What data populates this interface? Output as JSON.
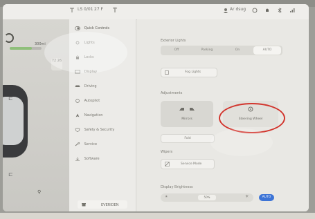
{
  "status_bar": {
    "location": "LS 0/01",
    "temp": "27 F",
    "profile": "Ar dsug",
    "range": "300mi"
  },
  "car_panel": {
    "range_label": "300mi",
    "range_fraction": 0.7,
    "temp_value": "72 26"
  },
  "menu": {
    "items": [
      {
        "label": "Quick Controls",
        "icon": "toggle-icon"
      },
      {
        "label": "Lights",
        "icon": "bulb-icon"
      },
      {
        "label": "Locks",
        "icon": "lock-icon"
      },
      {
        "label": "Display",
        "icon": "display-icon"
      },
      {
        "label": "Driving",
        "icon": "car-icon"
      },
      {
        "label": "Autopilot",
        "icon": "steering-icon"
      },
      {
        "label": "Navigation",
        "icon": "nav-icon"
      },
      {
        "label": "Safety & Security",
        "icon": "shield-icon"
      },
      {
        "label": "Service",
        "icon": "wrench-icon"
      },
      {
        "label": "Software",
        "icon": "download-icon"
      }
    ],
    "footer_label": "EVERIDEN"
  },
  "content": {
    "exterior_lights": {
      "title": "Exterior Lights",
      "options": [
        "Off",
        "Parking",
        "On",
        "AUTO"
      ],
      "selected": "AUTO"
    },
    "fog_button": "Fog Lights",
    "adjustments": {
      "title": "Adjustments",
      "mirrors_label": "Mirrors",
      "steering_label": "Steering Wheel",
      "fold_button": "Fold"
    },
    "wipers": {
      "title": "Wipers",
      "button": "Service Mode"
    },
    "brightness": {
      "title": "Display Brightness",
      "value": "50%",
      "auto_label": "AUTO",
      "level_percent": 50
    }
  },
  "colors": {
    "accent": "#3d74d6",
    "annotation": "#d2352d"
  }
}
